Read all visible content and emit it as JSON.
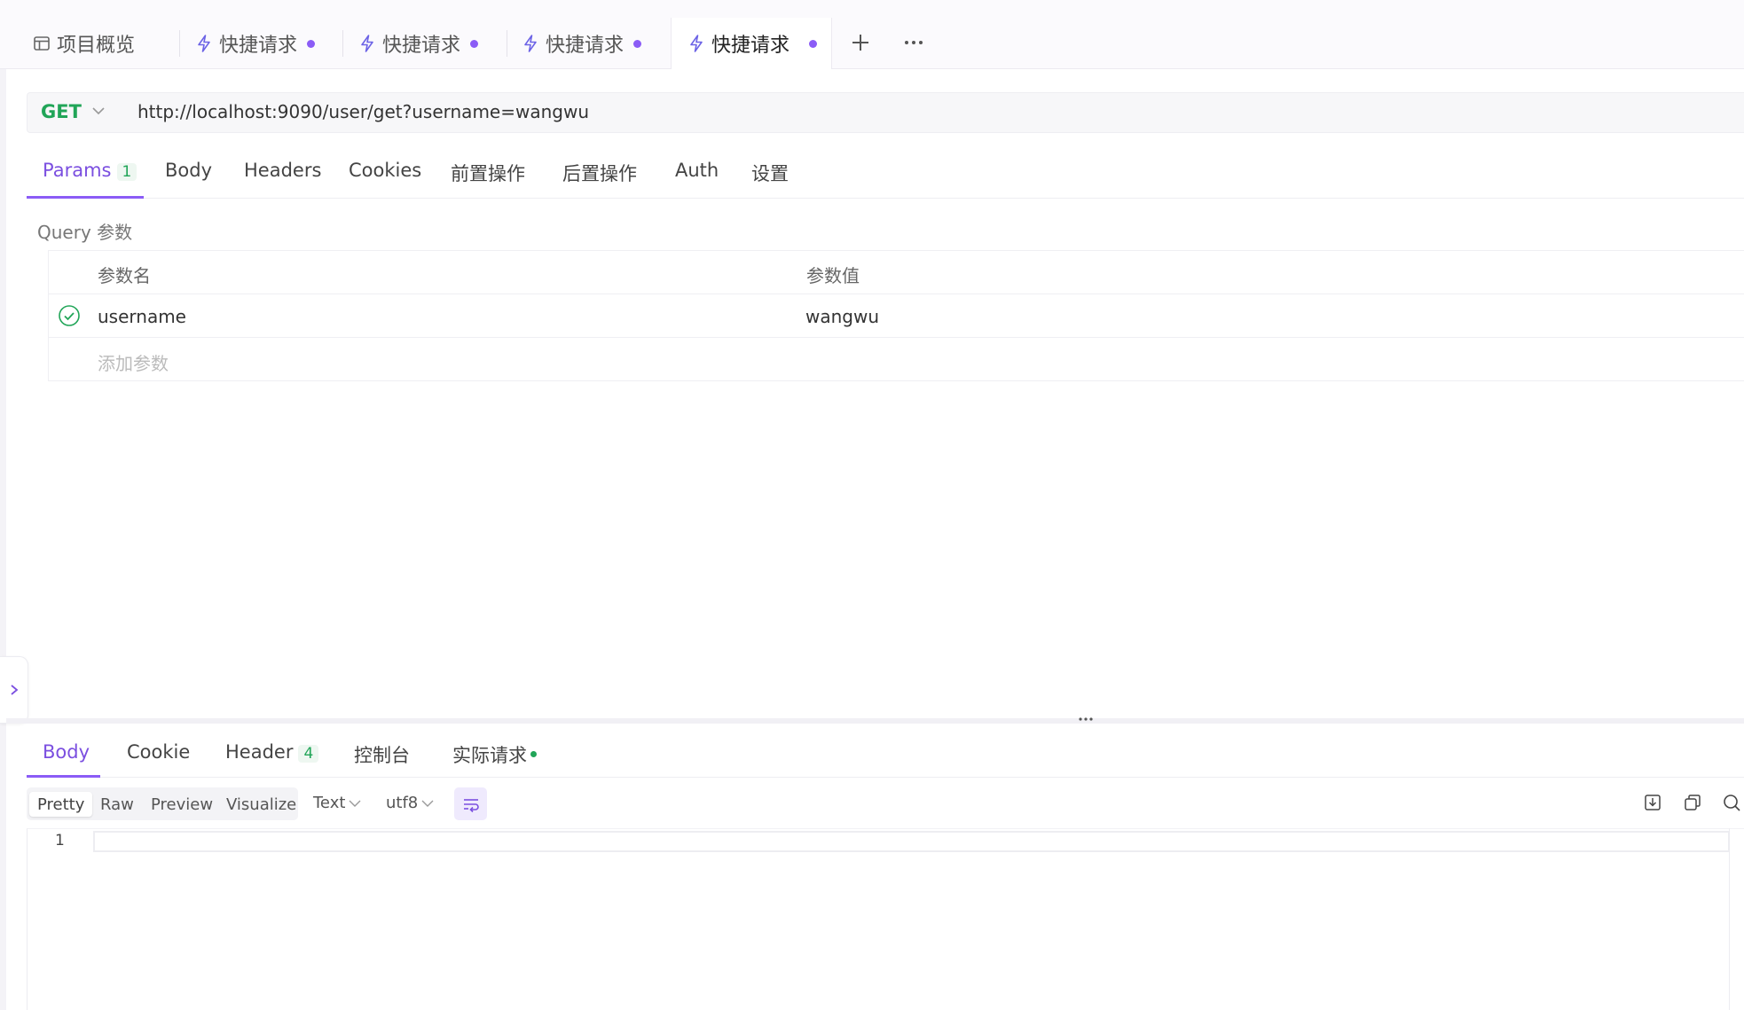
{
  "tabs": [
    {
      "label": "项目概览",
      "icon": "layout-icon",
      "active": false,
      "modified": false
    },
    {
      "label": "快捷请求",
      "icon": "lightning-icon",
      "active": false,
      "modified": true
    },
    {
      "label": "快捷请求",
      "icon": "lightning-icon",
      "active": false,
      "modified": true
    },
    {
      "label": "快捷请求",
      "icon": "lightning-icon",
      "active": false,
      "modified": true
    },
    {
      "label": "快捷请求",
      "icon": "lightning-icon",
      "active": true,
      "modified": true
    }
  ],
  "request": {
    "method": "GET",
    "url": "http://localhost:9090/user/get?username=wangwu"
  },
  "request_tabs": [
    {
      "label": "Params",
      "badge": "1",
      "active": true
    },
    {
      "label": "Body"
    },
    {
      "label": "Headers"
    },
    {
      "label": "Cookies"
    },
    {
      "label": "前置操作"
    },
    {
      "label": "后置操作"
    },
    {
      "label": "Auth"
    },
    {
      "label": "设置"
    }
  ],
  "query": {
    "label": "Query 参数",
    "col_name": "参数名",
    "col_value": "参数值",
    "params": [
      {
        "name": "username",
        "value": "wangwu",
        "enabled": true
      }
    ],
    "add_placeholder": "添加参数"
  },
  "response_tabs": [
    {
      "label": "Body",
      "active": true
    },
    {
      "label": "Cookie"
    },
    {
      "label": "Header",
      "badge": "4"
    },
    {
      "label": "控制台"
    },
    {
      "label": "实际请求",
      "dot": true
    }
  ],
  "view_modes": [
    "Pretty",
    "Raw",
    "Preview",
    "Visualize"
  ],
  "active_view_mode": "Pretty",
  "format": "Text",
  "encoding": "utf8",
  "editor": {
    "line_numbers": [
      "1"
    ]
  },
  "colors": {
    "accent": "#8b5cf6",
    "method_get": "#21a558",
    "badge_green": "#21a558"
  }
}
